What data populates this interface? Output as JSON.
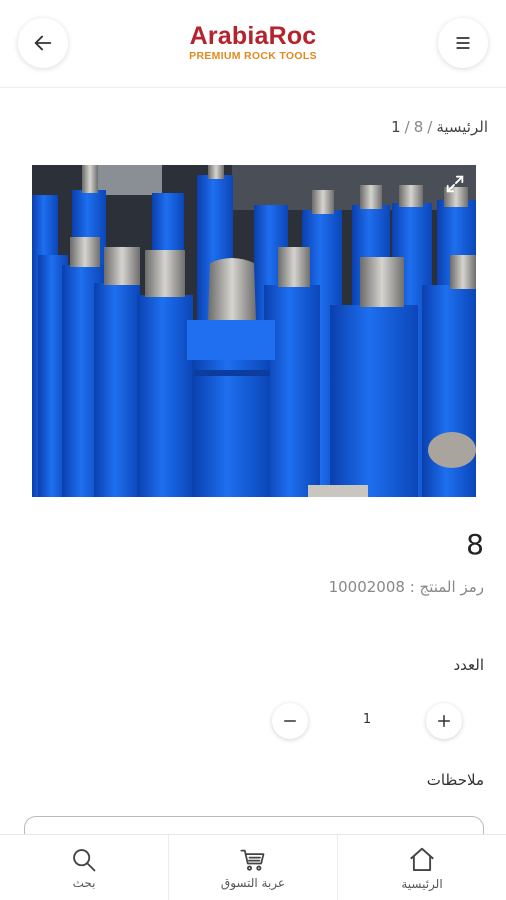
{
  "header": {
    "logo_main": "ArabiaRoc",
    "logo_sub": "PREMIUM ROCK TOOLS",
    "back_icon": "arrow-left-icon",
    "menu_icon": "hamburger-menu-icon"
  },
  "breadcrumb": {
    "home": "الرئيسية",
    "category": "1",
    "current": "8"
  },
  "product": {
    "image_alt": "Blue DTH hammers with threaded tops",
    "name": "8",
    "sku_label": "رمز المنتج :",
    "sku_value": "10002008"
  },
  "quantity": {
    "label": "العدد",
    "value": "1"
  },
  "notes": {
    "label": "ملاحظات"
  },
  "bottom_nav": {
    "search": "بحث",
    "cart": "عربة التسوق",
    "home": "الرئيسية"
  },
  "colors": {
    "brand_red": "#b5232c",
    "brand_orange": "#e08a1e"
  }
}
